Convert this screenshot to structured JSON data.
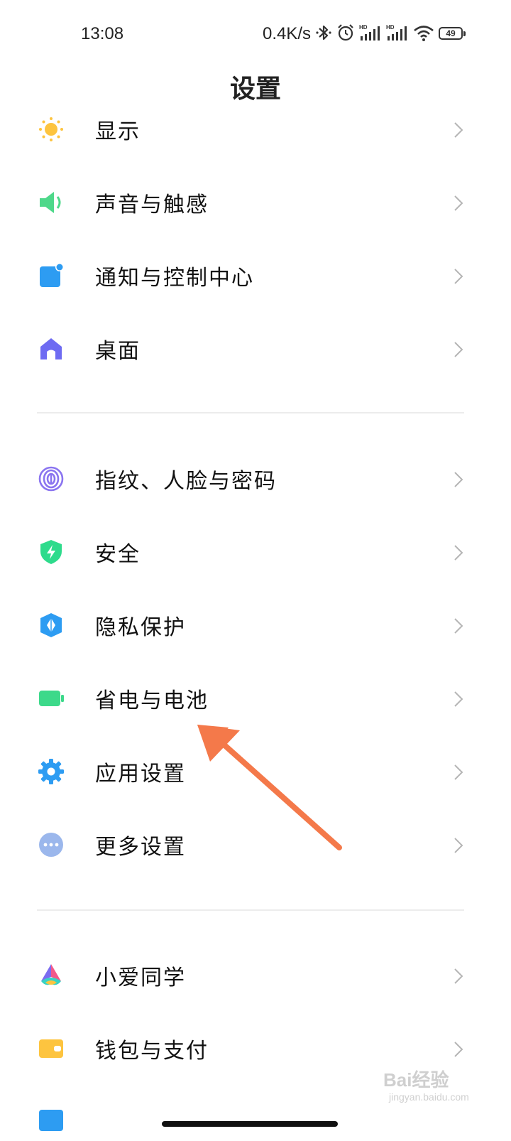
{
  "status_bar": {
    "time": "13:08",
    "net_speed": "0.4K/s",
    "battery_level": "49",
    "icons": [
      "bluetooth-icon",
      "alarm-icon",
      "hd-signal-icon",
      "hd-signal-icon",
      "wifi-icon",
      "battery-icon"
    ]
  },
  "page": {
    "title": "设置"
  },
  "settings": {
    "items": [
      {
        "label": "显示",
        "icon": "sun-icon",
        "color": "#FDC43F"
      },
      {
        "label": "声音与触感",
        "icon": "speaker-icon",
        "color": "#4ED88A"
      },
      {
        "label": "通知与控制中心",
        "icon": "notification-icon",
        "color": "#2D9CF2"
      },
      {
        "label": "桌面",
        "icon": "home-icon",
        "color": "#6E6BF2"
      },
      {
        "label": "指纹、人脸与密码",
        "icon": "fingerprint-icon",
        "color": "#8A74F0"
      },
      {
        "label": "安全",
        "icon": "shield-icon",
        "color": "#2EDB8C"
      },
      {
        "label": "隐私保护",
        "icon": "privacy-icon",
        "color": "#2D9CF2"
      },
      {
        "label": "省电与电池",
        "icon": "battery-icon",
        "color": "#3CD98A"
      },
      {
        "label": "应用设置",
        "icon": "gear-icon",
        "color": "#2D9CF2"
      },
      {
        "label": "更多设置",
        "icon": "more-icon",
        "color": "#9BB7EC"
      },
      {
        "label": "小爱同学",
        "icon": "xiaoai-icon",
        "color": "#F25A8A"
      },
      {
        "label": "钱包与支付",
        "icon": "wallet-icon",
        "color": "#FDC43F"
      }
    ]
  },
  "annotation": {
    "color": "#F4794A"
  },
  "watermark": {
    "text": "Bai经验",
    "sub": "jingyan.baidu.com"
  }
}
